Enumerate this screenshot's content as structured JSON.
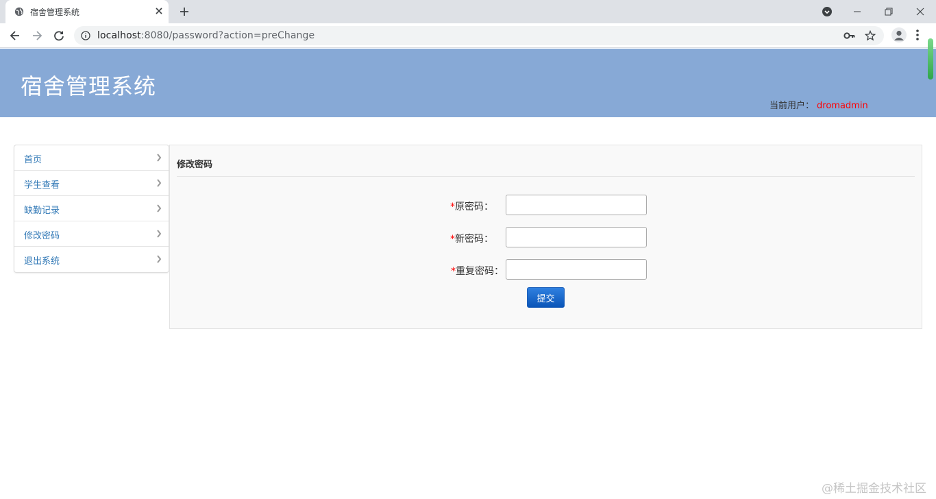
{
  "browser": {
    "tab_title": "宿舍管理系统",
    "url_host": "localhost",
    "url_rest": ":8080/password?action=preChange"
  },
  "header": {
    "app_title": "宿舍管理系统",
    "current_user_label": "当前用户：",
    "current_user_name": "dromadmin"
  },
  "sidebar": {
    "items": [
      {
        "label": "首页"
      },
      {
        "label": "学生查看"
      },
      {
        "label": "缺勤记录"
      },
      {
        "label": "修改密码"
      },
      {
        "label": "退出系统"
      }
    ]
  },
  "panel": {
    "title": "修改密码",
    "required_mark": "*",
    "fields": [
      {
        "label": "原密码：",
        "value": ""
      },
      {
        "label": "新密码：",
        "value": ""
      },
      {
        "label": "重复密码：",
        "value": ""
      }
    ],
    "submit_label": "提交"
  },
  "watermark": "@稀土掘金技术社区",
  "colors": {
    "header_bg": "#87a9d6",
    "link": "#337ab7",
    "required": "#ff0000",
    "username": "#ff0000",
    "submit_bg": "#0a55b8"
  }
}
